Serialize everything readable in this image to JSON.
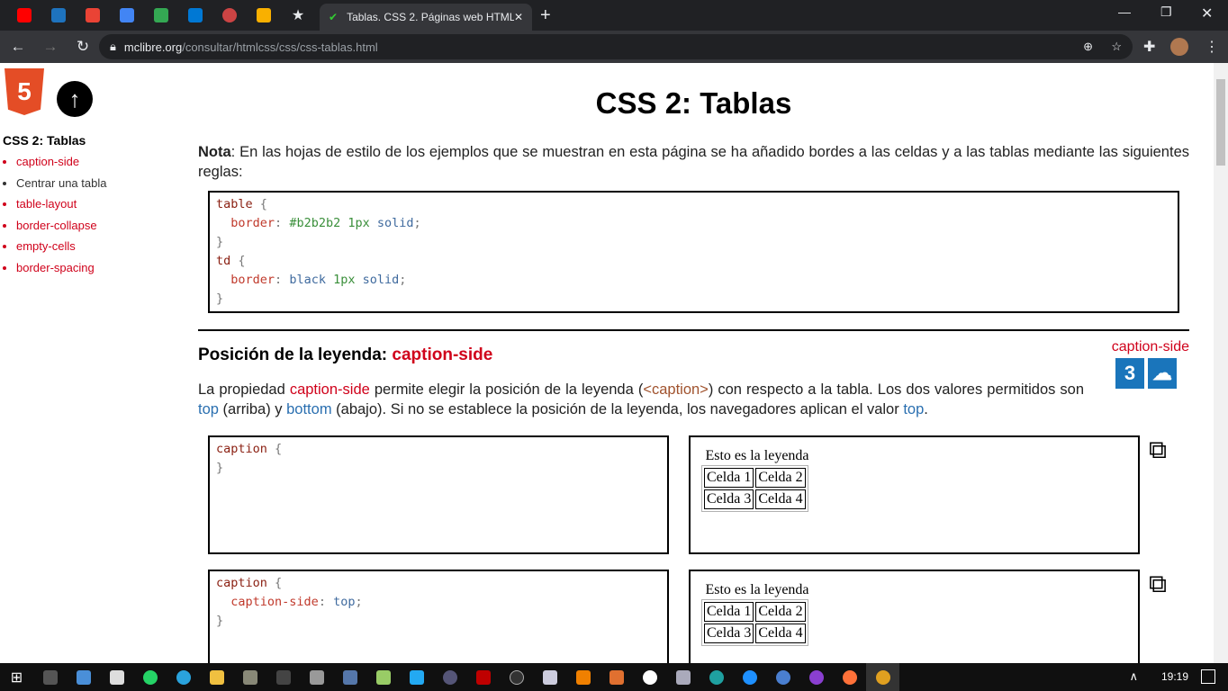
{
  "browser": {
    "tab_title": "Tablas. CSS 2. Páginas web HTML",
    "url_domain": "mclibre.org",
    "url_path": "/consultar/htmlcss/css/css-tablas.html",
    "favorites": [
      {
        "name": "youtube",
        "color": "#ff0000"
      },
      {
        "name": "asm",
        "color": "#1e73be"
      },
      {
        "name": "gmail",
        "color": "#ea4335"
      },
      {
        "name": "calendar",
        "color": "#4285f4"
      },
      {
        "name": "drive",
        "color": "#34a853"
      },
      {
        "name": "mail",
        "color": "#0078d4"
      },
      {
        "name": "app",
        "color": "#c44"
      },
      {
        "name": "moodle",
        "color": "#f9b000"
      }
    ]
  },
  "sidebar": {
    "title": "CSS 2: Tablas",
    "items": [
      "caption-side",
      "Centrar una tabla",
      "table-layout",
      "border-collapse",
      "empty-cells",
      "border-spacing"
    ]
  },
  "main": {
    "title": "CSS 2: Tablas",
    "note_label": "Nota",
    "note_text": ": En las hojas de estilo de los ejemplos que se muestran en esta página se ha añadido bordes a las celdas y a las tablas mediante las siguientes reglas:",
    "code": {
      "sel1": "table",
      "prop1": "border",
      "val1a": "#b2b2b2",
      "val1b": "1px",
      "val1c": "solid",
      "sel2": "td",
      "prop2": "border",
      "val2a": "black",
      "val2b": "1px",
      "val2c": "solid"
    },
    "section_title": "Posición de la leyenda: ",
    "section_prop": "caption-side",
    "ref_label": "caption-side",
    "para": {
      "t1": "La propiedad ",
      "p1": "caption-side",
      "t2": " permite elegir la posición de la leyenda (",
      "p2": "<caption>",
      "t3": ") con respecto a la tabla. Los dos valores permitidos son ",
      "p3": "top",
      "t4": " (arriba) y ",
      "p4": "bottom",
      "t5": " (abajo). Si no se establece la posición de la leyenda, los navegadores aplican el valor ",
      "p5": "top",
      "t6": "."
    },
    "examples": [
      {
        "sel": "caption",
        "prop": "",
        "val": ""
      },
      {
        "sel": "caption",
        "prop": "caption-side",
        "val": "top"
      }
    ],
    "caption": "Esto es la leyenda",
    "cells": [
      "Celda 1",
      "Celda 2",
      "Celda 3",
      "Celda 4"
    ]
  },
  "taskbar": {
    "time": "19:19"
  }
}
